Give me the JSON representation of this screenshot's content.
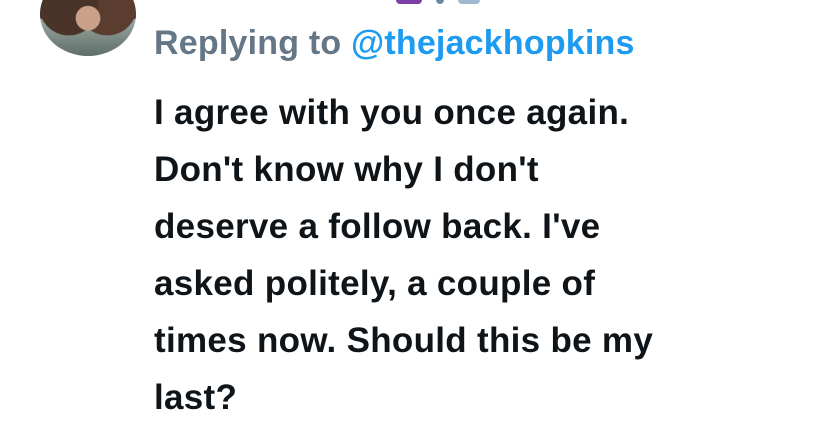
{
  "reply": {
    "prefix": "Replying to ",
    "handle": "@thejackhopkins"
  },
  "tweet": {
    "lines": [
      "I agree with you once again.",
      "Don't know why I don't",
      "deserve a follow back. I've",
      "asked politely, a couple of",
      "times now. Should this be my",
      "last?"
    ]
  },
  "colors": {
    "handle": "#1d9bf0",
    "secondary_text": "#657786",
    "primary_text": "#0f1419"
  }
}
